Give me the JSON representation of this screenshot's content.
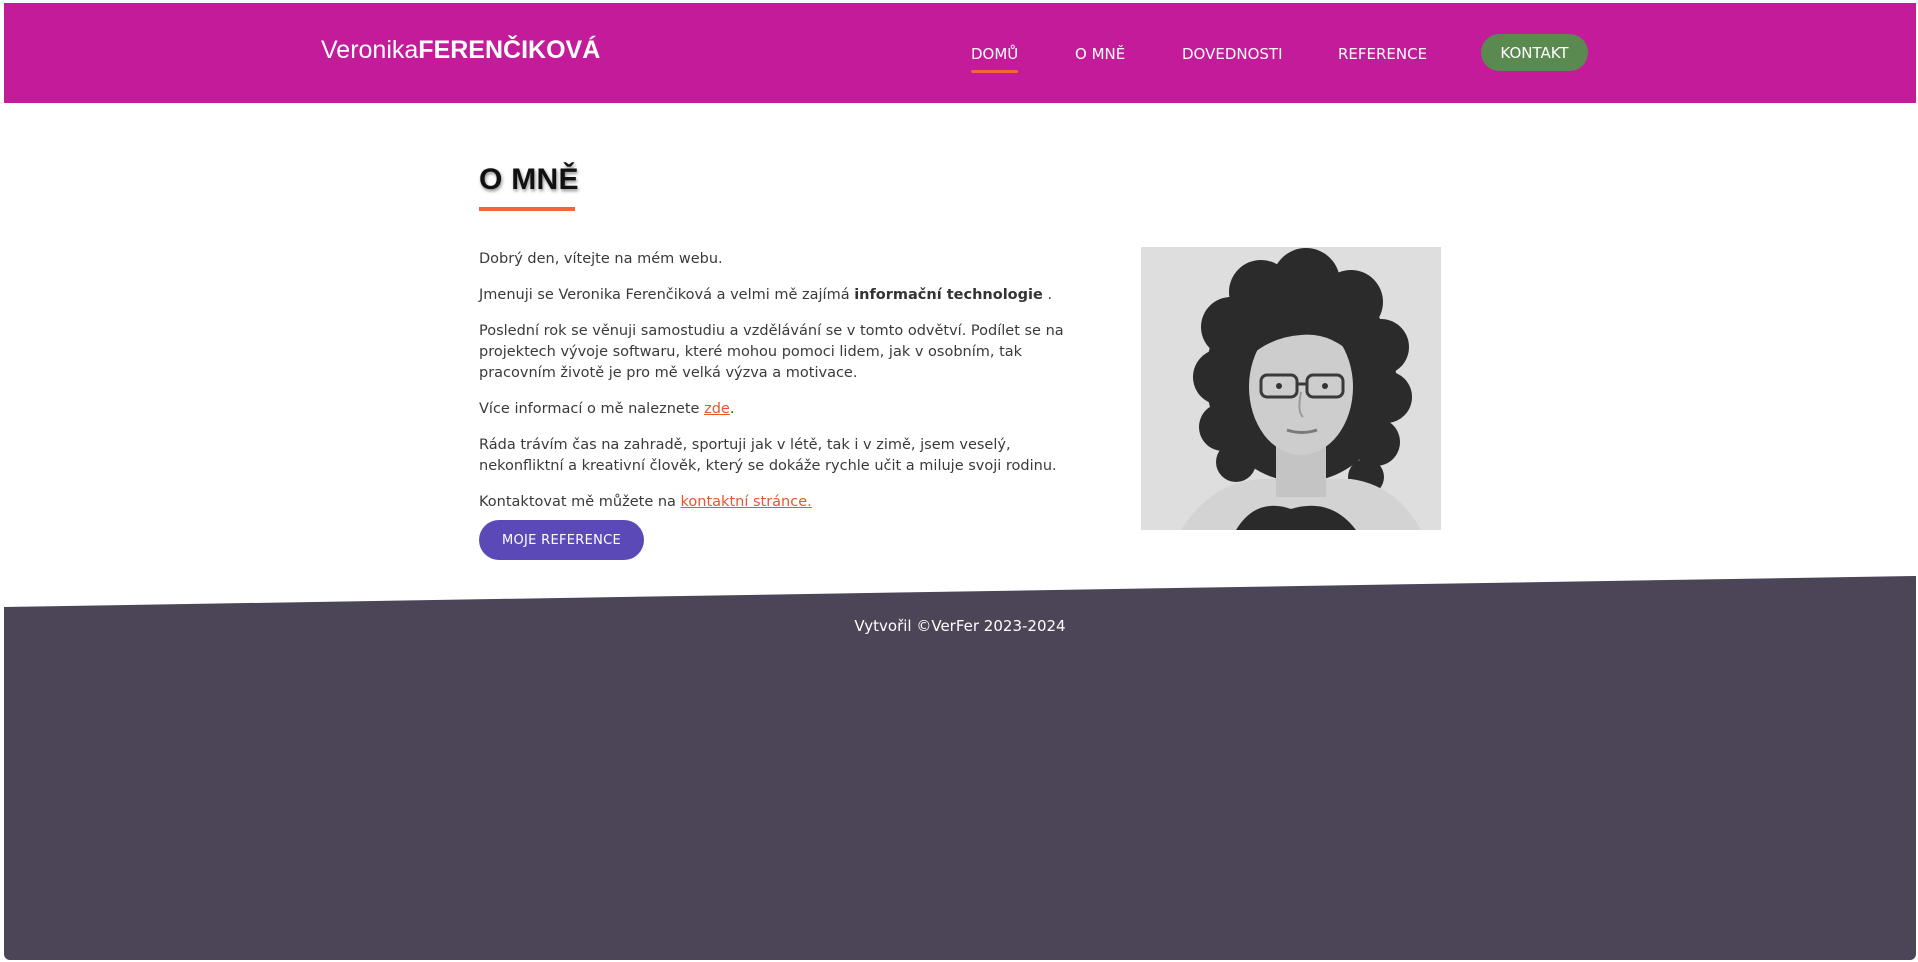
{
  "header": {
    "brand_first": "Veronika",
    "brand_last": "FERENČIKOVÁ",
    "nav": [
      {
        "label": "DOMŮ",
        "active": true
      },
      {
        "label": "O MNĚ"
      },
      {
        "label": "DOVEDNOSTI"
      },
      {
        "label": "REFERENCE"
      }
    ],
    "contact_label": "KONTAKT"
  },
  "main": {
    "title": "O MNĚ",
    "p1": "Dobrý den, vítejte na mém webu.",
    "p2_before": "Jmenuji se Veronika Ferenčiková a velmi mě zajímá ",
    "p2_bold": "informační technologie",
    "p2_after": " .",
    "p3": "Poslední rok se věnuji samostudiu a vzdělávání se v tomto odvětví. Podílet se na projektech vývoje softwaru, které mohou pomoci lidem, jak v osobním, tak pracovním životě je pro mě velká výzva a motivace.",
    "p4_before": "Více informací o mě naleznete ",
    "p4_link": "zde",
    "p4_after": ".",
    "p5": "Ráda trávím čas na zahradě, sportuji jak v létě, tak i v zimě, jsem veselý, nekonfliktní a kreativní člověk, který se dokáže rychle učit a miluje svoji rodinu.",
    "p6_before": "Kontaktovat mě můžete na ",
    "p6_link": "kontaktní stránce.",
    "refs_button": "MOJE REFERENCE"
  },
  "footer": {
    "text": "Vytvořil ©VerFer 2023-2024"
  },
  "colors": {
    "header": "#c41b9a",
    "accent": "#f0663a",
    "contact_button": "#5a8a50",
    "refs_button": "#5c49b8",
    "footer": "#4b4557"
  }
}
